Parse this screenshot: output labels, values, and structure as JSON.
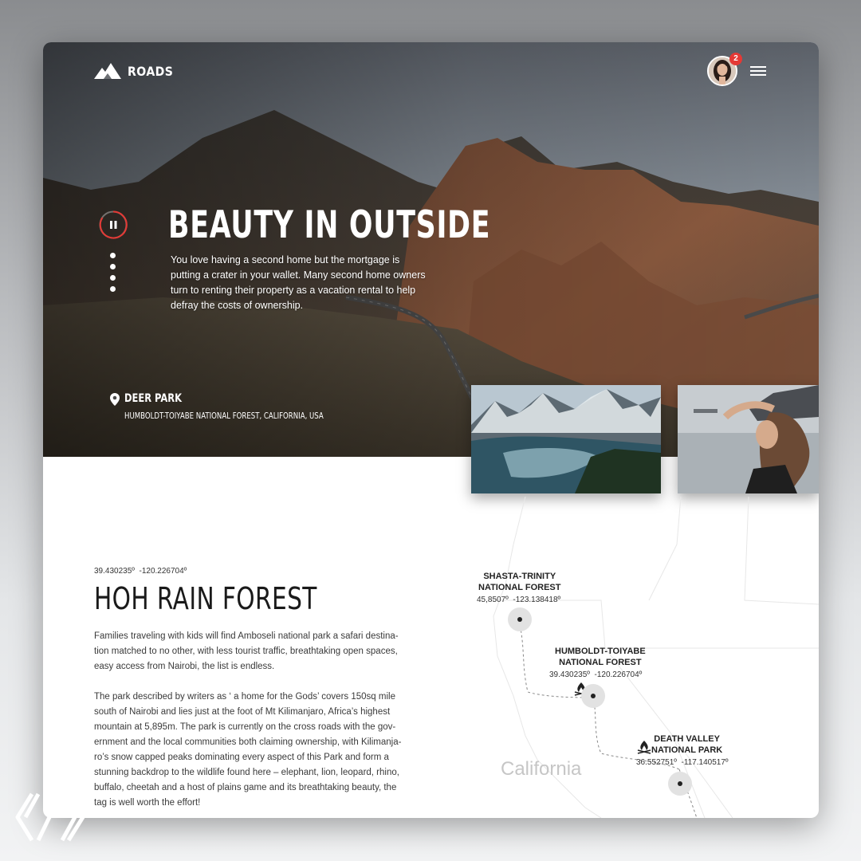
{
  "header": {
    "brand": "ROADS",
    "notification_count": "2"
  },
  "hero": {
    "title": "BEAUTY IN OUTSIDE",
    "description": "You love having a second home but the mortgage is putting a crater in your wallet. Many second home owners turn to renting their property as a vacation rental to help defray the costs of ownership.",
    "location_name": "DEER PARK",
    "location_detail": "HUMBOLDT-TOIYABE NATIONAL FOREST, CALIFORNIA, USA",
    "slides_count": 4,
    "accent_color": "#e53935"
  },
  "content": {
    "lat": "39.430235º",
    "lng": "-120.226704º",
    "title": "HOH RAIN FOREST",
    "paragraph1": "Families traveling with kids will find Amboseli national park a safari destina-tion matched to no other, with less tourist traffic, breathtaking open spaces, easy access from Nairobi, the list is endless.",
    "paragraph2": "The park described by writers as ‘ a home for the Gods’ covers 150sq mile south of Nairobi and lies just at the foot of Mt Kilimanjaro, Africa’s highest mountain at 5,895m. The park is currently on the cross roads with the gov-ernment and the local communities both claiming ownership, with Kilimanja-ro’s snow capped peaks dominating every aspect of this Park and form a stunning backdrop to the wildlife found here – elephant, lion, leopard, rhino, buffalo, cheetah and a host of plains game and its breathtaking beauty, the tag is well worth the effort!"
  },
  "map": {
    "state_label": "California",
    "locations": [
      {
        "name_line1": "SHASTA-TRINITY",
        "name_line2": "NATIONAL FOREST",
        "lat": "45,8507º",
        "lng": "-123.138418º"
      },
      {
        "name_line1": "HUMBOLDT-TOIYABE",
        "name_line2": "NATIONAL FOREST",
        "lat": "39.430235º",
        "lng": "-120.226704º"
      },
      {
        "name_line1": "DEATH VALLEY",
        "name_line2": "NATIONAL PARK",
        "lat": "36.552751º",
        "lng": "-117.140517º"
      }
    ],
    "campsite_icon": "campfire-icon"
  }
}
